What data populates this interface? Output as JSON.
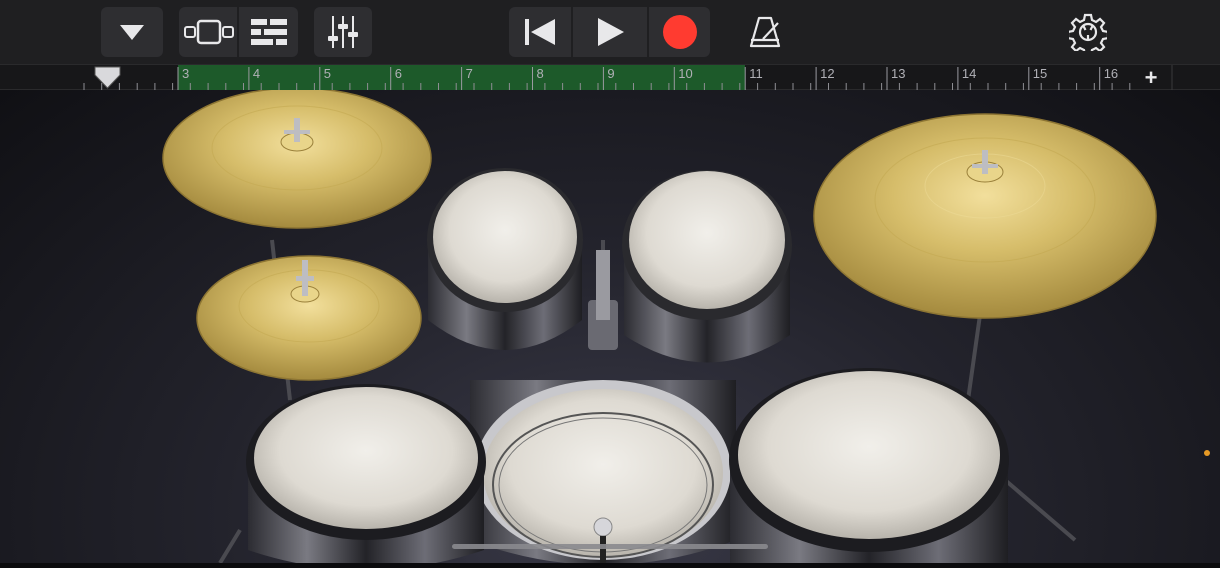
{
  "toolbar": {
    "buttons": [
      {
        "name": "navigation-menu-button",
        "icon": "triangle-down-icon"
      },
      {
        "name": "view-toggle-button",
        "icon": "instrument-view-icon"
      },
      {
        "name": "tracks-view-button",
        "icon": "tracks-list-icon"
      },
      {
        "name": "mixer-button",
        "icon": "mixer-sliders-icon"
      },
      {
        "name": "go-to-beginning-button",
        "icon": "skip-back-icon"
      },
      {
        "name": "play-button",
        "icon": "play-icon"
      },
      {
        "name": "record-button",
        "icon": "record-icon"
      },
      {
        "name": "metronome-button",
        "icon": "metronome-icon"
      },
      {
        "name": "settings-button",
        "icon": "gear-icon"
      }
    ],
    "record_color": "#ff3b30"
  },
  "ruler": {
    "bar_numbers": [
      "3",
      "4",
      "5",
      "6",
      "7",
      "8",
      "9",
      "10",
      "11",
      "12",
      "13",
      "14",
      "15",
      "16"
    ],
    "add_label": "+",
    "loop_color": "#1d5a2a"
  },
  "instruments": [
    {
      "name": "crash-cymbal-left",
      "icon": "cymbal-icon"
    },
    {
      "name": "hi-hat-cymbal",
      "icon": "cymbal-icon"
    },
    {
      "name": "ride-cymbal",
      "icon": "cymbal-icon"
    },
    {
      "name": "tom-left",
      "icon": "drum-icon"
    },
    {
      "name": "tom-right",
      "icon": "drum-icon"
    },
    {
      "name": "snare-drum",
      "icon": "drum-icon"
    },
    {
      "name": "kick-drum",
      "icon": "drum-icon"
    },
    {
      "name": "floor-tom",
      "icon": "drum-icon"
    }
  ]
}
